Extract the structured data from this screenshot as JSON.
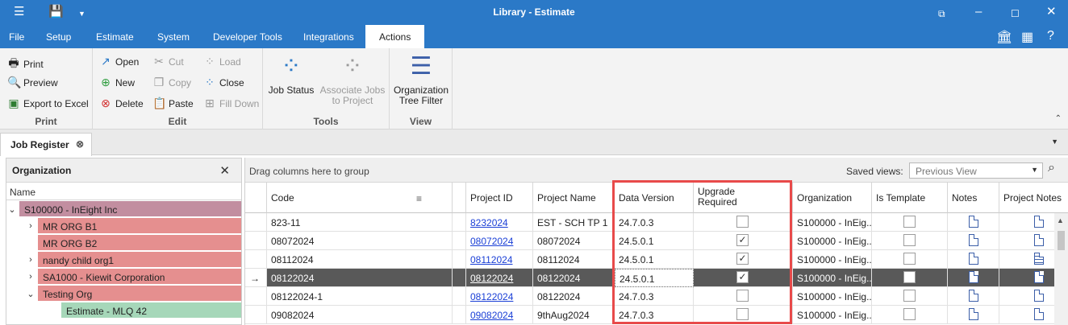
{
  "window": {
    "title": "Library - Estimate"
  },
  "menus": [
    "File",
    "Setup",
    "Estimate",
    "System",
    "Developer Tools",
    "Integrations",
    "Actions"
  ],
  "ribbon": {
    "print_group": {
      "title": "Print",
      "print": "Print",
      "preview": "Preview",
      "export": "Export to Excel"
    },
    "edit_group": {
      "title": "Edit",
      "open": "Open",
      "new": "New",
      "delete": "Delete",
      "cut": "Cut",
      "copy": "Copy",
      "paste": "Paste",
      "load": "Load",
      "close": "Close",
      "filldown": "Fill Down"
    },
    "tools_group": {
      "title": "Tools",
      "job_status": "Job Status",
      "associate": "Associate Jobs to Project"
    },
    "view_group": {
      "title": "View",
      "org_filter": "Organization Tree Filter"
    }
  },
  "doc_tab": {
    "label": "Job Register"
  },
  "org_panel": {
    "title": "Organization",
    "column": "Name",
    "rows": [
      {
        "label": "S100000 - InEight Inc",
        "color": "#c28ea0",
        "indent": 0,
        "chev": "v"
      },
      {
        "label": "MR ORG B1",
        "color": "#e58f8f",
        "indent": 1,
        "chev": ">"
      },
      {
        "label": "MR ORG B2",
        "color": "#e58f8f",
        "indent": 1,
        "chev": ""
      },
      {
        "label": "nandy child org1",
        "color": "#e58f8f",
        "indent": 1,
        "chev": ">"
      },
      {
        "label": "SA1000 - Kiewit Corporation",
        "color": "#e58f8f",
        "indent": 1,
        "chev": ">"
      },
      {
        "label": "Testing Org",
        "color": "#e58f8f",
        "indent": 1,
        "chev": "v"
      },
      {
        "label": "Estimate - MLQ 42",
        "color": "#a6d7b9",
        "indent": 2,
        "chev": ""
      }
    ]
  },
  "grid": {
    "group_hint": "Drag columns here to group",
    "saved_views_label": "Saved views:",
    "saved_views_value": "Previous View",
    "columns": [
      "Code",
      "Project ID",
      "Project Name",
      "Data Version",
      "Upgrade Required",
      "Organization",
      "Is Template",
      "Notes",
      "Project Notes"
    ],
    "rows": [
      {
        "code": " 823-11",
        "project_id": "8232024",
        "project_name": "EST - SCH TP 1",
        "data_version": "24.7.0.3",
        "upgrade": false,
        "org": "S100000 - InEig...",
        "template": false,
        "pn_lines": false,
        "selected": false
      },
      {
        "code": "08072024",
        "project_id": "08072024",
        "project_name": "08072024",
        "data_version": "24.5.0.1",
        "upgrade": true,
        "org": "S100000 - InEig...",
        "template": false,
        "pn_lines": false,
        "selected": false
      },
      {
        "code": "08112024",
        "project_id": "08112024",
        "project_name": "08112024",
        "data_version": "24.5.0.1",
        "upgrade": true,
        "org": "S100000 - InEig...",
        "template": false,
        "pn_lines": true,
        "selected": false
      },
      {
        "code": "08122024",
        "project_id": "08122024",
        "project_name": "08122024",
        "data_version": "24.5.0.1",
        "upgrade": true,
        "org": "S100000 - InEig...",
        "template": false,
        "pn_lines": false,
        "selected": true
      },
      {
        "code": "08122024-1",
        "project_id": "08122024",
        "project_name": "08122024",
        "data_version": "24.7.0.3",
        "upgrade": false,
        "org": "S100000 - InEig...",
        "template": false,
        "pn_lines": false,
        "selected": false
      },
      {
        "code": "09082024",
        "project_id": "09082024",
        "project_name": "9thAug2024",
        "data_version": "24.7.0.3",
        "upgrade": false,
        "org": "S100000 - InEig...",
        "template": false,
        "pn_lines": false,
        "selected": false
      }
    ]
  },
  "colors": {
    "titlebar": "#2b79c7",
    "highlight_box": "#e84a4a",
    "selected_row": "#595959"
  }
}
